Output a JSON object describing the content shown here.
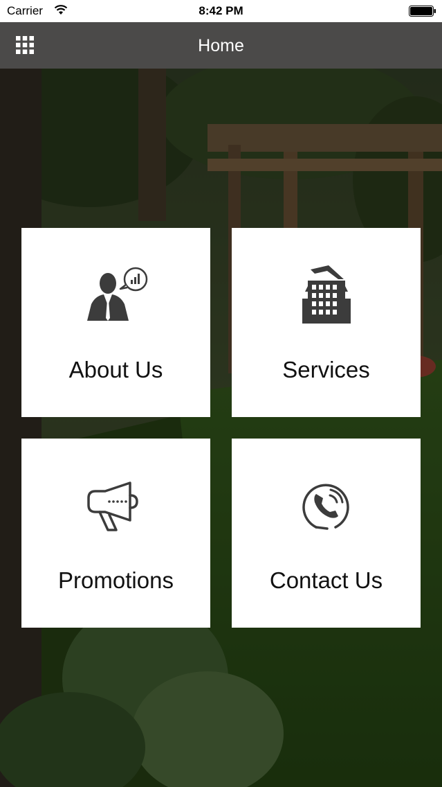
{
  "status_bar": {
    "carrier": "Carrier",
    "time": "8:42 PM"
  },
  "nav": {
    "title": "Home",
    "menu_icon": "grid-menu-icon"
  },
  "tiles": [
    {
      "label": "About Us",
      "icon": "businessman-chat-icon"
    },
    {
      "label": "Services",
      "icon": "building-icon"
    },
    {
      "label": "Promotions",
      "icon": "megaphone-icon"
    },
    {
      "label": "Contact Us",
      "icon": "phone-icon"
    }
  ],
  "colors": {
    "nav_bar": "#4b4a49",
    "tile_background": "#ffffff",
    "icon": "#3c3c3c",
    "label": "#111111"
  }
}
